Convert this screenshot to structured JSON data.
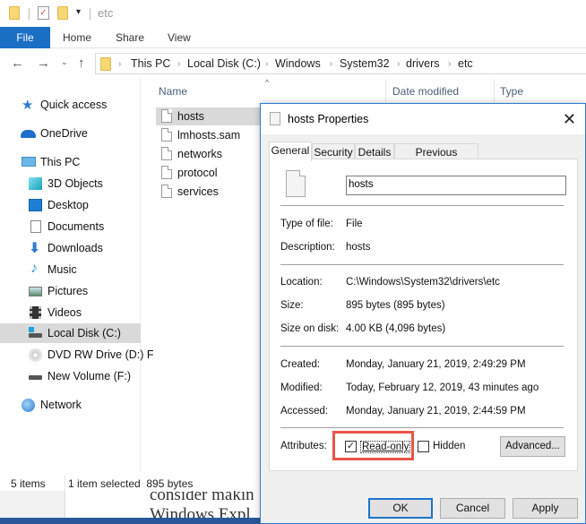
{
  "explorer": {
    "title": "etc",
    "ribbon_tabs": [
      "File",
      "Home",
      "Share",
      "View"
    ],
    "breadcrumb": [
      "This PC",
      "Local Disk (C:)",
      "Windows",
      "System32",
      "drivers",
      "etc"
    ],
    "columns": [
      "Name",
      "Date modified",
      "Type"
    ],
    "sidebar": [
      {
        "label": "Quick access",
        "icon": "star-icon"
      },
      {
        "label": "OneDrive",
        "icon": "cloud-icon"
      },
      {
        "label": "This PC",
        "icon": "computer-icon"
      },
      {
        "label": "3D Objects",
        "icon": "cube-icon"
      },
      {
        "label": "Desktop",
        "icon": "desktop-icon"
      },
      {
        "label": "Documents",
        "icon": "documents-icon"
      },
      {
        "label": "Downloads",
        "icon": "download-icon"
      },
      {
        "label": "Music",
        "icon": "music-icon"
      },
      {
        "label": "Pictures",
        "icon": "pictures-icon"
      },
      {
        "label": "Videos",
        "icon": "videos-icon"
      },
      {
        "label": "Local Disk (C:)",
        "icon": "drive-icon",
        "selected": true
      },
      {
        "label": "DVD RW Drive (D:) F",
        "icon": "dvd-icon"
      },
      {
        "label": "New Volume (F:)",
        "icon": "drive-icon"
      },
      {
        "label": "Network",
        "icon": "network-icon"
      }
    ],
    "files": [
      {
        "name": "hosts",
        "selected": true
      },
      {
        "name": "lmhosts.sam"
      },
      {
        "name": "networks"
      },
      {
        "name": "protocol"
      },
      {
        "name": "services"
      }
    ],
    "status": {
      "count": "5 items",
      "selection": "1 item selected  895 bytes"
    }
  },
  "background_doc": {
    "line1": "consider makin",
    "line2": "Windows Expl"
  },
  "dialog": {
    "title": "hosts Properties",
    "tabs": [
      "General",
      "Security",
      "Details",
      "Previous Versions"
    ],
    "active_tab": "General",
    "filename": "hosts",
    "fields": {
      "type_label": "Type of file:",
      "type_value": "File",
      "desc_label": "Description:",
      "desc_value": "hosts",
      "location_label": "Location:",
      "location_value": "C:\\Windows\\System32\\drivers\\etc",
      "size_label": "Size:",
      "size_value": "895 bytes (895 bytes)",
      "disk_label": "Size on disk:",
      "disk_value": "4.00 KB (4,096 bytes)",
      "created_label": "Created:",
      "created_value": "Monday, January 21, 2019, 2:49:29 PM",
      "modified_label": "Modified:",
      "modified_value": "Today, February 12, 2019, 43 minutes ago",
      "accessed_label": "Accessed:",
      "accessed_value": "Monday, January 21, 2019, 2:44:59 PM",
      "attributes_label": "Attributes:"
    },
    "attributes": {
      "readonly_label": "Read-only",
      "readonly_checked": true,
      "hidden_label": "Hidden",
      "hidden_checked": false,
      "advanced_label": "Advanced..."
    },
    "buttons": {
      "ok": "OK",
      "cancel": "Cancel",
      "apply": "Apply"
    },
    "highlight_color": "#e8564a"
  }
}
